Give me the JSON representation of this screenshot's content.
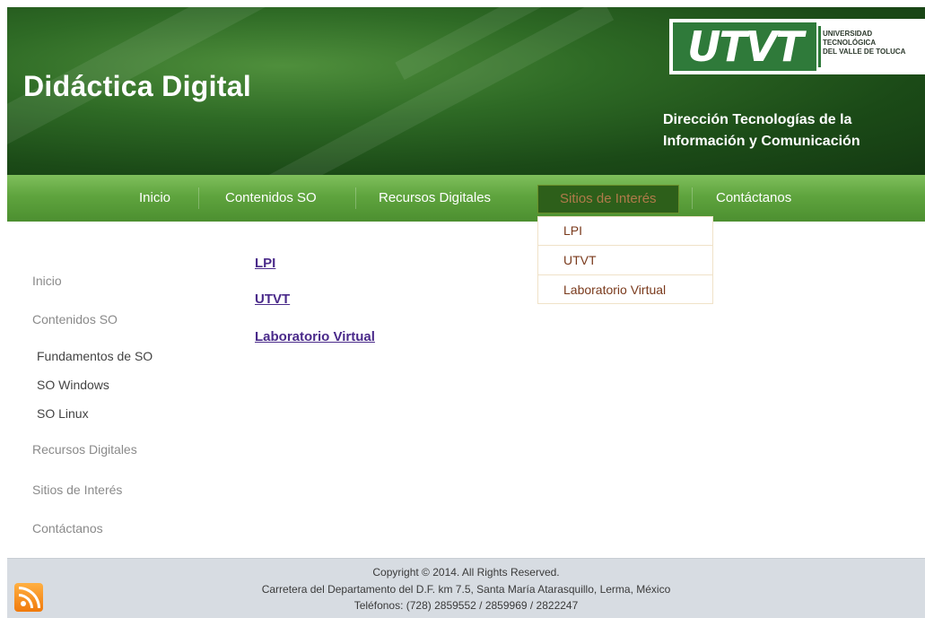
{
  "header": {
    "site_title": "Didáctica Digital",
    "logo": {
      "mark": "UTVT",
      "line1": "UNIVERSIDAD",
      "line2": "TECNOLÓGICA",
      "line3": "DEL VALLE DE TOLUCA"
    },
    "subtitle_line1": "Dirección Tecnologías de la",
    "subtitle_line2": "Información y Comunicación"
  },
  "nav": {
    "items": [
      {
        "label": "Inicio"
      },
      {
        "label": "Contenidos SO"
      },
      {
        "label": "Recursos Digitales"
      },
      {
        "label": "Sitios de Interés",
        "active": true
      },
      {
        "label": "Contáctanos"
      }
    ],
    "dropdown": [
      {
        "label": "LPI"
      },
      {
        "label": "UTVT"
      },
      {
        "label": "Laboratorio Virtual"
      }
    ]
  },
  "sidebar": {
    "items": [
      {
        "label": "Inicio"
      },
      {
        "label": "Contenidos SO"
      },
      {
        "label": "Fundamentos de SO"
      },
      {
        "label": "SO Windows"
      },
      {
        "label": "SO Linux"
      },
      {
        "label": "Recursos Digitales"
      },
      {
        "label": "Sitios de Interés"
      },
      {
        "label": "Contáctanos"
      }
    ]
  },
  "main": {
    "links": [
      {
        "label": "LPI"
      },
      {
        "label": "UTVT"
      },
      {
        "label": "Laboratorio Virtual"
      }
    ]
  },
  "footer": {
    "copyright": "Copyright © 2014. All Rights Reserved.",
    "address": "Carretera del Departamento del D.F. km 7.5, Santa María Atarasquillo, Lerma, México",
    "phones": "Teléfonos: (728) 2859552 / 2859969 / 2822247",
    "rss_icon": "rss-icon"
  },
  "colors": {
    "header_green": "#2e6a25",
    "nav_green": "#5fa43e",
    "link_purple": "#4a2a8a",
    "dropdown_text": "#7a3a1c",
    "footer_bg": "#d7dce2"
  }
}
